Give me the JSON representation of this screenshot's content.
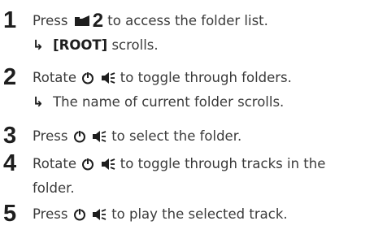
{
  "steps": [
    {
      "number": "1",
      "parts": {
        "before": "Press",
        "key_label": "2",
        "after": "to access the folder list."
      },
      "result": {
        "bracket": "[ROOT]",
        "rest": "scrolls."
      }
    },
    {
      "number": "2",
      "parts": {
        "before": "Rotate",
        "after": "to toggle through folders."
      },
      "result": {
        "text": "The name of current folder scrolls."
      }
    },
    {
      "number": "3",
      "parts": {
        "before": "Press",
        "after": "to select the folder."
      }
    },
    {
      "number": "4",
      "parts": {
        "before": "Rotate",
        "after": "to toggle through tracks in the"
      },
      "continuation": "folder."
    },
    {
      "number": "5",
      "parts": {
        "before": "Press",
        "after": "to play the selected track."
      }
    }
  ],
  "icons": {
    "folder_key": "folder-icon",
    "power": "power-icon",
    "volume": "volume-icon"
  },
  "result_arrow": "↳"
}
